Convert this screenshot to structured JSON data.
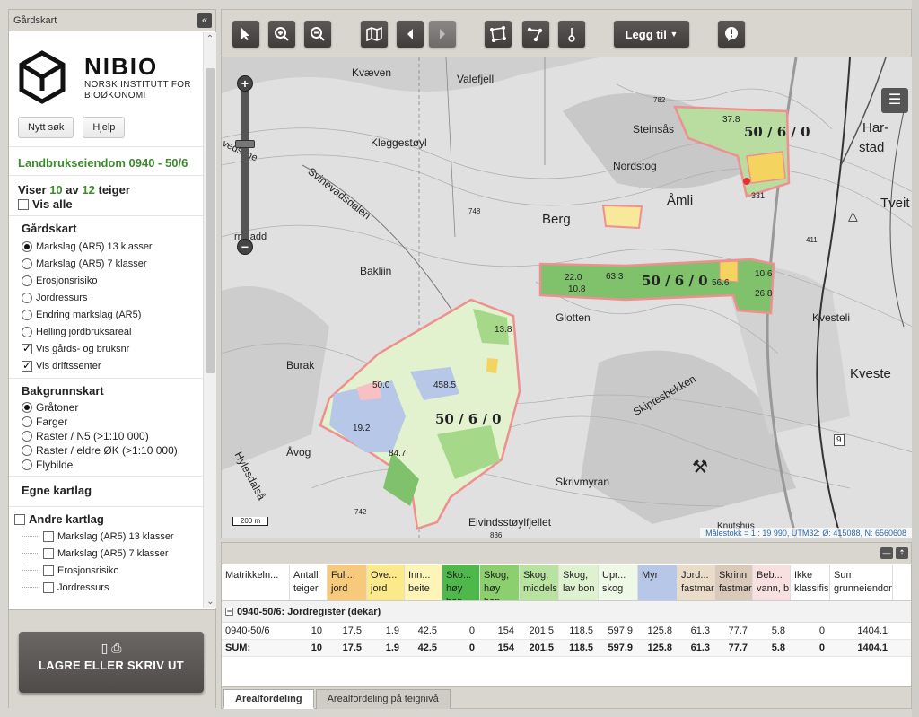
{
  "left_panel": {
    "title": "Gårdskart",
    "collapse_glyph": "«",
    "logo": {
      "name": "NIBIO",
      "line1": "NORSK INSTITUTT FOR",
      "line2": "BIOØKONOMI"
    },
    "buttons": {
      "new_search": "Nytt søk",
      "help": "Hjelp"
    },
    "property_title": "Landbrukseiendom 0940 - 50/6",
    "viser": {
      "prefix": "Viser",
      "shown": "10",
      "middle": "av",
      "total": "12",
      "suffix": "teiger"
    },
    "vis_alle": "Vis alle",
    "gardskart": {
      "heading": "Gårdskart",
      "options": [
        {
          "label": "Markslag (AR5) 13 klasser",
          "type": "radio",
          "checked": true
        },
        {
          "label": "Markslag (AR5) 7 klasser",
          "type": "radio",
          "checked": false
        },
        {
          "label": "Erosjonsrisiko",
          "type": "radio",
          "checked": false
        },
        {
          "label": "Jordressurs",
          "type": "radio",
          "checked": false
        },
        {
          "label": "Endring markslag (AR5)",
          "type": "radio",
          "checked": false
        },
        {
          "label": "Helling jordbruksareal",
          "type": "radio",
          "checked": false
        },
        {
          "label": "Vis gårds- og bruksnr",
          "type": "check",
          "checked": true
        },
        {
          "label": "Vis driftssenter",
          "type": "check",
          "checked": true
        }
      ]
    },
    "bakgrunnskart": {
      "heading": "Bakgrunnskart",
      "options": [
        {
          "label": "Gråtoner",
          "checked": true
        },
        {
          "label": "Farger",
          "checked": false
        },
        {
          "label": "Raster / N5 (>1:10 000)",
          "checked": false
        },
        {
          "label": "Raster / eldre ØK (>1:10 000)",
          "checked": false
        },
        {
          "label": "Flybilde",
          "checked": false
        }
      ]
    },
    "egne_kartlag": "Egne kartlag",
    "andre_kartlag": {
      "heading": "Andre kartlag",
      "items": [
        "Markslag (AR5) 13 klasser",
        "Markslag (AR5) 7 klasser",
        "Erosjonsrisiko",
        "Jordressurs"
      ]
    },
    "save_button": "LAGRE ELLER SKRIV UT",
    "save_icons": "▯ ⎙"
  },
  "toolbar": {
    "legg_til": "Legg til",
    "legg_til_arrow": "▼",
    "icons": [
      "pointer-icon",
      "zoom-in-icon",
      "zoom-out-icon",
      "map-icon",
      "prev-icon",
      "next-icon",
      "polygon-icon",
      "line-icon",
      "point-icon",
      "info-icon"
    ]
  },
  "map": {
    "labels": [
      "Kvæven",
      "Valefjell",
      "Steinsås",
      "Har-",
      "stad",
      "Kleggestøyl",
      "Nordstog",
      "Åmli",
      "Tveit",
      "Berg",
      "Svinevadsdalen",
      "Bakliin",
      "Glotten",
      "Kvesteli",
      "Burak",
      "Kveste",
      "Skiptesbekken",
      "Åvog",
      "Hylesdalså",
      "Skrivmyran",
      "Eivindsstøylfjellet",
      "Knutshus",
      "vedsåne",
      "rrlifiadd"
    ],
    "parcel_labels": [
      "50 / 6 / 0",
      "50 / 6 / 0",
      "50 / 6 / 0"
    ],
    "area_labels": [
      "37.8",
      "22.0",
      "10.8",
      "63.3",
      "56.6",
      "10.6",
      "26.8",
      "50.0",
      "458.5",
      "13.8",
      "19.2",
      "84.7"
    ],
    "spot_heights": [
      "782",
      "748",
      "411",
      "742",
      "836",
      "331"
    ],
    "road_numbers": [
      "9"
    ],
    "scale_text": "200 m",
    "coords": "Målestokk = 1 : 19 990, UTM32: Ø: 415088, N: 6560608",
    "zoom_in": "+",
    "zoom_out": "−"
  },
  "bottom_panel": {
    "columns": [
      {
        "label": "Matrikkeln...",
        "color": "#ffffff"
      },
      {
        "label": "Antall teiger",
        "color": "#ffffff"
      },
      {
        "label": "Full... jord",
        "color": "#f7c97a"
      },
      {
        "label": "Ove... jord",
        "color": "#fbe98a"
      },
      {
        "label": "Inn... beite",
        "color": "#fdf5b8"
      },
      {
        "label": "Sko... høy bon",
        "color": "#4fb84a"
      },
      {
        "label": "Skog, høy bon",
        "color": "#8bcf6e"
      },
      {
        "label": "Skog, middels",
        "color": "#b8e2a0"
      },
      {
        "label": "Skog, lav bon",
        "color": "#dff2cf"
      },
      {
        "label": "Upr... skog",
        "color": "#eef8e6"
      },
      {
        "label": "Myr",
        "color": "#b7c7e8"
      },
      {
        "label": "Jord... fastmar",
        "color": "#e9dcc8"
      },
      {
        "label": "Skrinn fastmar",
        "color": "#d9c9b8"
      },
      {
        "label": "Beb... vann, b",
        "color": "#f8e0e0"
      },
      {
        "label": "Ikke klassifis",
        "color": "#ffffff"
      },
      {
        "label": "Sum grunneiendom",
        "color": "#ffffff"
      }
    ],
    "group_label": "0940-50/6: Jordregister (dekar)",
    "rows": [
      {
        "cells": [
          "0940-50/6",
          "10",
          "17.5",
          "1.9",
          "42.5",
          "0",
          "154",
          "201.5",
          "118.5",
          "597.9",
          "125.8",
          "61.3",
          "77.7",
          "5.8",
          "0",
          "1404.1"
        ]
      },
      {
        "cells": [
          "SUM:",
          "10",
          "17.5",
          "1.9",
          "42.5",
          "0",
          "154",
          "201.5",
          "118.5",
          "597.9",
          "125.8",
          "61.3",
          "77.7",
          "5.8",
          "0",
          "1404.1"
        ]
      }
    ],
    "tabs": [
      "Arealfordeling",
      "Arealfordeling på teignivå"
    ]
  }
}
